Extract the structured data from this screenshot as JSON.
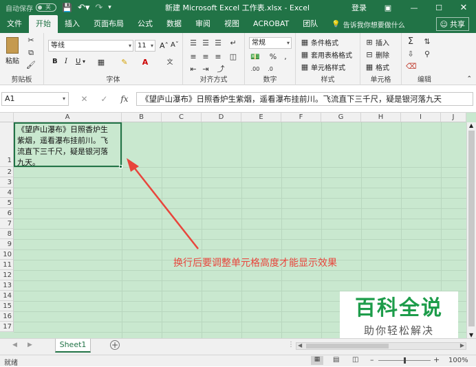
{
  "titlebar": {
    "autosave_label": "自动保存",
    "autosave_state": "关",
    "title": "新建 Microsoft Excel 工作表.xlsx  -  Excel",
    "login": "登录"
  },
  "tabs": [
    {
      "label": "文件",
      "active": false
    },
    {
      "label": "开始",
      "active": true
    },
    {
      "label": "插入",
      "active": false
    },
    {
      "label": "页面布局",
      "active": false
    },
    {
      "label": "公式",
      "active": false
    },
    {
      "label": "数据",
      "active": false
    },
    {
      "label": "审阅",
      "active": false
    },
    {
      "label": "视图",
      "active": false
    },
    {
      "label": "ACROBAT",
      "active": false
    },
    {
      "label": "团队",
      "active": false
    }
  ],
  "tell_me": "告诉我你想要做什么",
  "share": "共享",
  "ribbon": {
    "clipboard": {
      "label": "剪贴板",
      "paste": "粘贴"
    },
    "font": {
      "label": "字体",
      "font_name": "等线",
      "font_size": "11",
      "bold": "B",
      "italic": "I",
      "underline": "U"
    },
    "alignment": {
      "label": "对齐方式"
    },
    "number": {
      "label": "数字",
      "format": "常规"
    },
    "styles": {
      "label": "样式",
      "conditional": "条件格式",
      "table_format": "套用表格格式",
      "cell_styles": "单元格样式"
    },
    "cells": {
      "label": "单元格",
      "insert": "插入",
      "delete": "删除",
      "format": "格式"
    },
    "editing": {
      "label": "编辑"
    }
  },
  "formula_bar": {
    "name_box": "A1",
    "formula": "《望庐山瀑布》日照香炉生紫烟，遥看瀑布挂前川。飞流直下三千尺，疑是银河落九天"
  },
  "grid": {
    "columns": [
      "A",
      "B",
      "C",
      "D",
      "E",
      "F",
      "G",
      "H",
      "I",
      "J"
    ],
    "rows": [
      "1",
      "2",
      "3",
      "4",
      "5",
      "6",
      "7",
      "8",
      "9",
      "10",
      "11",
      "12",
      "13",
      "14",
      "15",
      "16",
      "17"
    ],
    "cell_a1_lines": [
      "《望庐山瀑布》日照香炉生",
      "紫烟，遥看瀑布挂前川。飞",
      "流直下三千尺，疑是银河落",
      "九天。"
    ]
  },
  "annotation": "换行后要调整单元格高度才能显示效果",
  "watermark": {
    "title": "百科全说",
    "subtitle": "助你轻松解决"
  },
  "sheets": [
    {
      "label": "Sheet1"
    }
  ],
  "status": {
    "ready": "就绪",
    "zoom": "100%"
  },
  "colors": {
    "excel_green": "#217346",
    "cell_bg": "#c9e8cf",
    "annotation_red": "#e8453c",
    "watermark_green": "#1d9c4a"
  }
}
